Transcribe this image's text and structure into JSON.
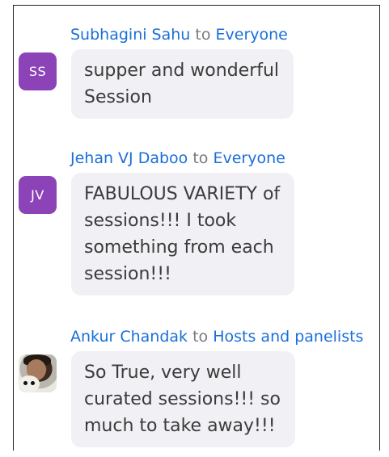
{
  "chat": {
    "messages": [
      {
        "sender": "Subhagini Sahu",
        "to_word": "to",
        "recipient": "Everyone",
        "avatar": {
          "type": "initials",
          "initials": "SS",
          "color": "#8c43b8"
        },
        "lines": [
          "supper and wonderful",
          "Session"
        ]
      },
      {
        "sender": "Jehan VJ Daboo",
        "to_word": "to",
        "recipient": "Everyone",
        "avatar": {
          "type": "initials",
          "initials": "JV",
          "color": "#8c43b8"
        },
        "lines": [
          "FABULOUS VARIETY of",
          "sessions!!! I took",
          "something from each",
          "session!!!"
        ]
      },
      {
        "sender": "Ankur Chandak",
        "to_word": "to",
        "recipient": "Hosts and panelists",
        "avatar": {
          "type": "photo",
          "icon": "user-photo-icon"
        },
        "lines": [
          "So True,  very well",
          "curated sessions!!! so",
          "much to take away!!!"
        ]
      }
    ]
  },
  "colors": {
    "link": "#1a6fd8",
    "muted": "#777a80",
    "bubble": "#f1f1f5",
    "text": "#3b3b3b"
  }
}
